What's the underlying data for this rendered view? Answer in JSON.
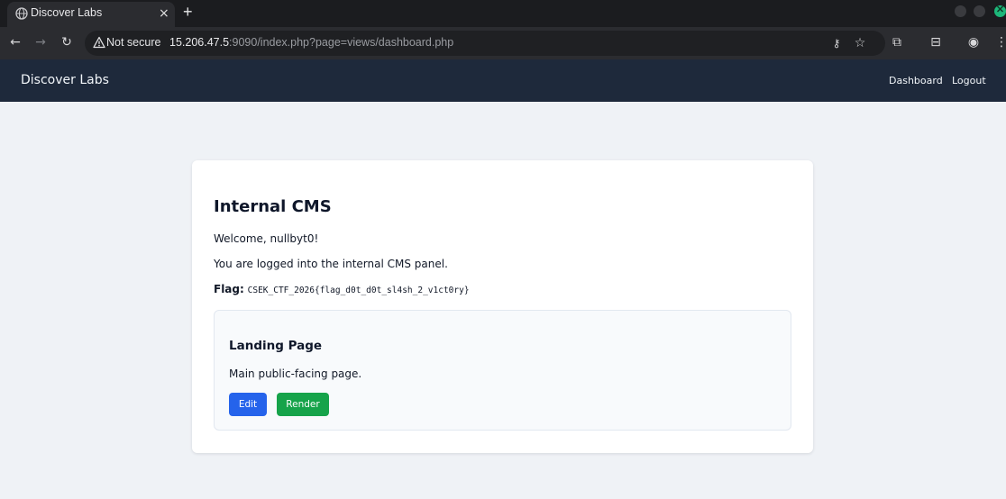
{
  "browser": {
    "tab_title": "Discover Labs",
    "tab_close": "×",
    "new_tab": "+",
    "security_label": "Not secure",
    "url_host": "15.206.47.5",
    "url_rest": ":9090/index.php?page=views/dashboard.php"
  },
  "site": {
    "brand": "Discover Labs",
    "nav": [
      "Dashboard",
      "Logout"
    ]
  },
  "card": {
    "title": "Internal CMS",
    "welcome": "Welcome, nullbyt0!",
    "logged_in": "You are logged into the internal CMS panel.",
    "flag_label": "Flag:",
    "flag_value": "CSEK_CTF_2026{flag_d0t_d0t_sl4sh_2_v1ct0ry}"
  },
  "page_item": {
    "title": "Landing Page",
    "description": "Main public-facing page.",
    "edit_label": "Edit",
    "render_label": "Render"
  },
  "colors": {
    "nav_bg": "#1e293b",
    "edit": "#2563eb",
    "render": "#16a34a",
    "page_bg": "#eff2f6"
  }
}
